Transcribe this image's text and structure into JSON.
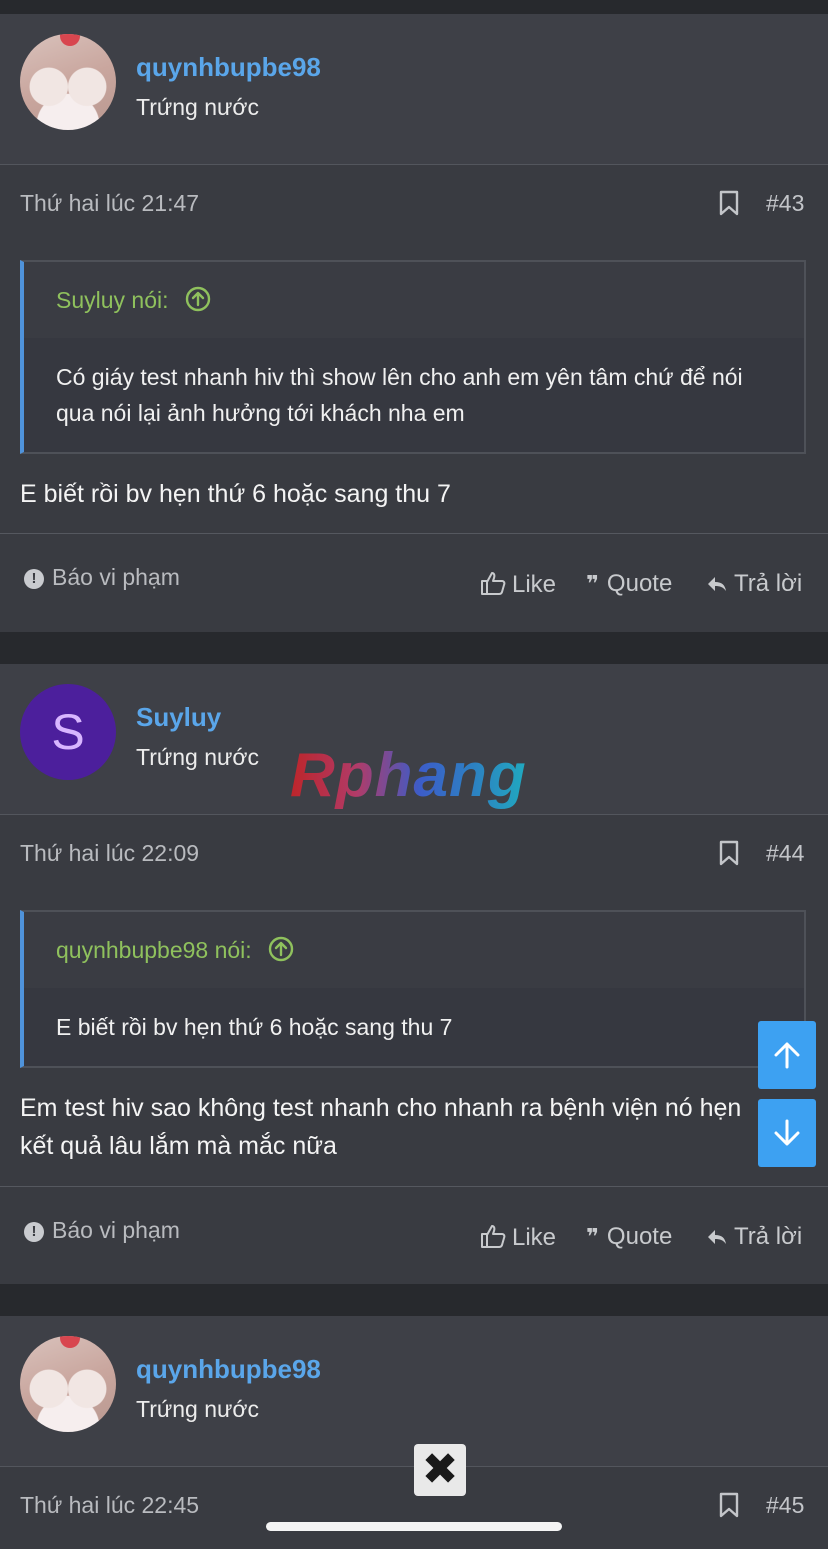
{
  "posts": [
    {
      "username": "quynhbupbe98",
      "rank": "Trứng nước",
      "avatar": "photo",
      "time": "Thứ hai lúc 21:47",
      "number": "#43",
      "quote": {
        "author": "Suyluy nói:",
        "text": "Có giáy test nhanh hiv thì show lên cho anh em yên tâm chứ để nói qua nói lại ảnh hưởng tới khách nha em"
      },
      "text": "E biết rồi bv hẹn thứ 6 hoặc sang thu 7"
    },
    {
      "username": "Suyluy",
      "rank": "Trứng nước",
      "avatar_letter": "S",
      "time": "Thứ hai lúc 22:09",
      "number": "#44",
      "quote": {
        "author": "quynhbupbe98 nói:",
        "text": "E biết rồi bv hẹn thứ 6 hoặc sang thu 7"
      },
      "text": "Em test hiv sao không test nhanh cho nhanh ra bệnh viện nó hẹn kết quả lâu lắm mà mắc nữa"
    },
    {
      "username": "quynhbupbe98",
      "rank": "Trứng nước",
      "avatar": "photo",
      "time": "Thứ hai lúc 22:45",
      "number": "#45"
    }
  ],
  "actions": {
    "report": "Báo vi phạm",
    "like": "Like",
    "quote": "Quote",
    "reply": "Trả lời"
  },
  "watermark": "Rphang",
  "icons": {
    "bookmark": "bookmark-icon",
    "quote_up": "arrow-up-circle-icon",
    "report": "exclamation-circle-icon",
    "like": "thumbs-up-icon",
    "quote": "quote-marks-icon",
    "reply": "reply-arrow-icon",
    "scroll_up": "arrow-up-icon",
    "scroll_down": "arrow-down-icon",
    "close": "close-icon"
  },
  "colors": {
    "username": "#5aa6ea",
    "quote_author": "#8fc15d",
    "quote_border": "#4f93db",
    "scroll_button": "#3da1f2",
    "avatar_letter_bg": "#4c1f9c"
  }
}
